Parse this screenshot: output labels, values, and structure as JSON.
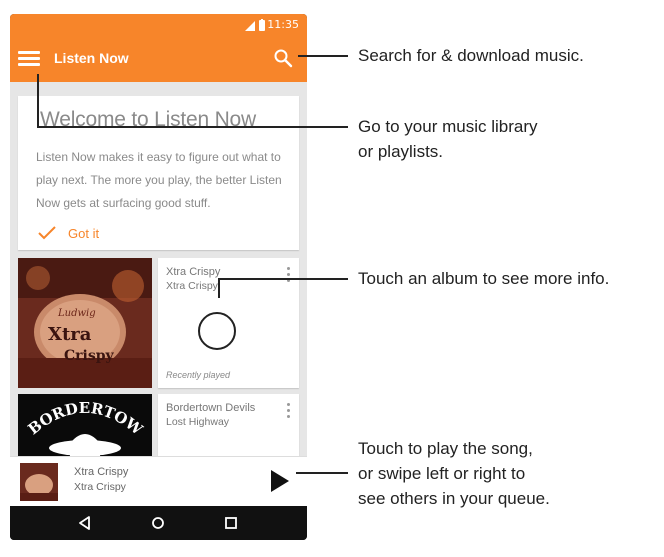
{
  "status_bar": {
    "time": "11:35"
  },
  "app_bar": {
    "title": "Listen Now"
  },
  "welcome_card": {
    "title": "Welcome to Listen Now",
    "body": "Listen Now makes it easy to figure out what to play next. The more you play, the better Listen Now gets at surfacing good stuff.",
    "action": "Got it"
  },
  "albums": [
    {
      "title": "Xtra Crispy",
      "artist": "Xtra Crispy",
      "note": "Recently played",
      "art_text_1": "Xtra",
      "art_text_2": "Crispy"
    },
    {
      "title": "Bordertown Devils",
      "artist": "Lost Highway",
      "art_text": "BORDERTOWN"
    }
  ],
  "now_playing": {
    "title": "Xtra Crispy",
    "artist": "Xtra Crispy"
  },
  "callouts": {
    "search": "Search for & download music.",
    "library_1": "Go to your music library",
    "library_2": "or playlists.",
    "album": "Touch an album to see more info.",
    "play_1": "Touch to play the song,",
    "play_2": "or swipe left or right to",
    "play_3": "see others in your queue."
  },
  "colors": {
    "accent": "#f7852a"
  },
  "icons": [
    "menu-icon",
    "search-icon",
    "check-icon",
    "more-vert-icon",
    "play-icon",
    "back-icon",
    "home-icon",
    "recents-icon"
  ]
}
